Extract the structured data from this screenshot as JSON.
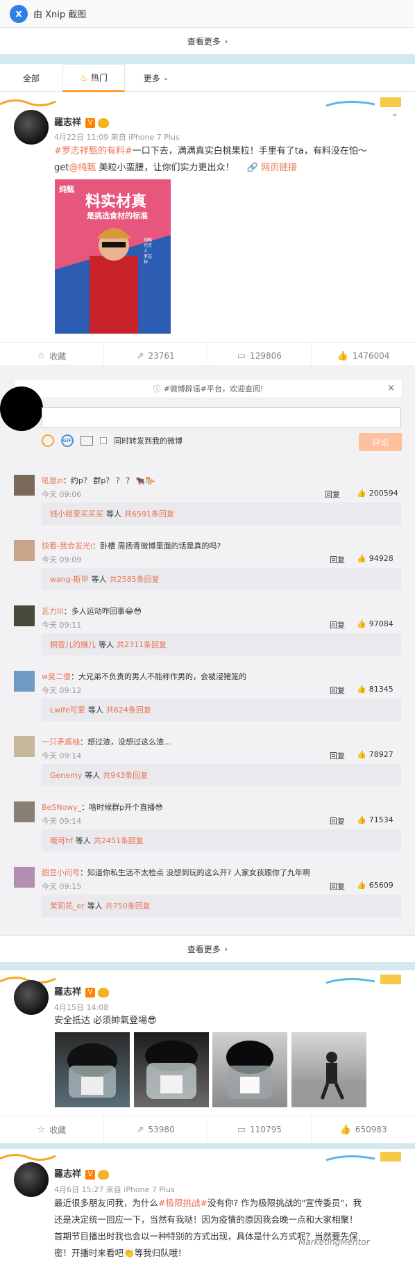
{
  "xnip": {
    "title": "由 Xnip 截图",
    "logo": "x"
  },
  "see_more": {
    "label": "查看更多"
  },
  "tabs": [
    {
      "label": "全部"
    },
    {
      "label": "热门",
      "icon": "fire-icon"
    },
    {
      "label": "更多",
      "icon": "chevron-down-icon"
    }
  ],
  "post1": {
    "user": "羅志祥",
    "badge": "V",
    "meta": "4月22日 11:09 来自 iPhone 7 Plus",
    "line1_tag": "#罗志祥甄的有料#",
    "line1_rest": "一口下去，满满真实白桃果粒！手里有了ta，有料没在怕～",
    "line2_pre": "get",
    "line2_at": "@纯甄",
    "line2_rest": " 美粒小蛮腰，让你们实力更出众！",
    "link": "网页链接",
    "ad_brand": "纯甄",
    "ad_title": "料实材真",
    "ad_sub": "是挑选食材的标准",
    "ad_side": "纯甄代言人 罗志祥",
    "actions": {
      "fav": "收藏",
      "repost": "23761",
      "comment": "129806",
      "like": "1476004"
    }
  },
  "comment_area": {
    "notice": "#微博辟谣#平台，欢迎查阅!",
    "sync_label": "同时转发到我的微博",
    "submit": "评论",
    "reply_label": "回复",
    "etc": "等人",
    "comments": [
      {
        "user": "吼崽zi",
        "text": "约p？ 群p？ ？ ？ 🐂🐎",
        "time": "今天 09:06",
        "likes": "200594",
        "sub_user": "钱小姐爱买买买",
        "sub_count": "共6591条回复"
      },
      {
        "user": "快看-我会发光i",
        "text": "卧槽 周扬青微博里面的话是真的吗?",
        "time": "今天 09:09",
        "likes": "94928",
        "sub_user": "wang-斯甲",
        "sub_count": "共2585条回复"
      },
      {
        "user": "瓦力III",
        "text": "多人运动咋回事😂😳",
        "time": "今天 09:11",
        "likes": "97084",
        "sub_user": "桐蓉儿的赚儿",
        "sub_count": "共2311条回复"
      },
      {
        "user": "w吴二傻",
        "text": "大兄弟不负责的男人不能称作男的，会被浸猪笼的",
        "time": "今天 09:12",
        "likes": "81345",
        "sub_user": "Lwife可爱",
        "sub_count": "共624条回复"
      },
      {
        "user": "一只矛盾柚",
        "text": "想过渣，没想过这么渣...",
        "time": "今天 09:14",
        "likes": "78927",
        "sub_user": "Genemy",
        "sub_count": "共943条回复"
      },
      {
        "user": "BeSNowy_",
        "text": "啥时候群p开个直播😳",
        "time": "今天 09:14",
        "likes": "71534",
        "sub_user": "哦可hf",
        "sub_count": "共2451条回复"
      },
      {
        "user": "甜豆小问号",
        "text": "知道你私生活不太检点 没想到玩的这么开? 人家女孩跟你了九年啊",
        "time": "今天 09:15",
        "likes": "65609",
        "sub_user": "茉莉花_er",
        "sub_count": "共750条回复"
      }
    ]
  },
  "post2": {
    "user": "羅志祥",
    "badge": "V",
    "meta": "4月15日 14:08",
    "text": "安全抵达 必须帥氣登場😎",
    "actions": {
      "fav": "收藏",
      "repost": "53980",
      "comment": "110795",
      "like": "650983"
    }
  },
  "post3": {
    "user": "羅志祥",
    "badge": "V",
    "meta": "4月6日 15:27 来自 iPhone 7 Plus",
    "line1_pre": "最近很多朋友问我，为什么",
    "line1_tag": "#极限挑战#",
    "line1_rest": "没有你? 作为极限挑战的\"宣传委员\"，我",
    "line2": "还是决定统一回应一下，当然有我哒！因为疫情的原因我会晚一点和大家相聚！",
    "line3": "首期节目播出时我也会以一种特别的方式出现，具体是什么方式呢？当然要先保",
    "line4": "密！开播时来看吧👏等我归队哦！"
  },
  "watermark": "MarketingMentor"
}
